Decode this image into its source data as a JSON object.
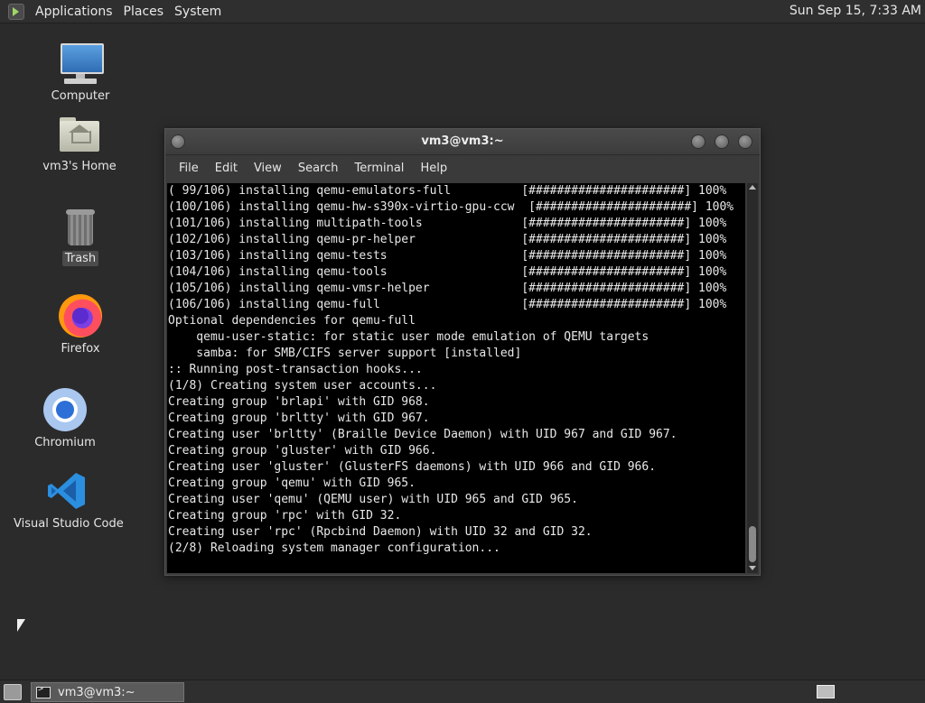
{
  "top_panel": {
    "menus": [
      "Applications",
      "Places",
      "System"
    ],
    "clock": "Sun Sep 15,  7:33 AM"
  },
  "desktop": {
    "icons": [
      {
        "label": "Computer",
        "icon": "computer-icon"
      },
      {
        "label": "vm3's Home",
        "icon": "home-folder-icon"
      },
      {
        "label": "Trash",
        "icon": "trash-icon"
      },
      {
        "label": "Firefox",
        "icon": "firefox-icon"
      },
      {
        "label": "Chromium",
        "icon": "chromium-icon"
      },
      {
        "label": "Visual Studio Code",
        "icon": "vscode-icon"
      }
    ]
  },
  "terminal": {
    "title": "vm3@vm3:~",
    "menu": [
      "File",
      "Edit",
      "View",
      "Search",
      "Terminal",
      "Help"
    ],
    "lines": [
      "( 99/106) installing qemu-emulators-full          [######################] 100%",
      "(100/106) installing qemu-hw-s390x-virtio-gpu-ccw  [######################] 100%",
      "(101/106) installing multipath-tools              [######################] 100%",
      "(102/106) installing qemu-pr-helper               [######################] 100%",
      "(103/106) installing qemu-tests                   [######################] 100%",
      "(104/106) installing qemu-tools                   [######################] 100%",
      "(105/106) installing qemu-vmsr-helper             [######################] 100%",
      "(106/106) installing qemu-full                    [######################] 100%",
      "Optional dependencies for qemu-full",
      "    qemu-user-static: for static user mode emulation of QEMU targets",
      "    samba: for SMB/CIFS server support [installed]",
      ":: Running post-transaction hooks...",
      "(1/8) Creating system user accounts...",
      "Creating group 'brlapi' with GID 968.",
      "Creating group 'brltty' with GID 967.",
      "Creating user 'brltty' (Braille Device Daemon) with UID 967 and GID 967.",
      "Creating group 'gluster' with GID 966.",
      "Creating user 'gluster' (GlusterFS daemons) with UID 966 and GID 966.",
      "Creating group 'qemu' with GID 965.",
      "Creating user 'qemu' (QEMU user) with UID 965 and GID 965.",
      "Creating group 'rpc' with GID 32.",
      "Creating user 'rpc' (Rpcbind Daemon) with UID 32 and GID 32.",
      "(2/8) Reloading system manager configuration..."
    ]
  },
  "bottom_panel": {
    "taskbar_item": "vm3@vm3:~"
  }
}
